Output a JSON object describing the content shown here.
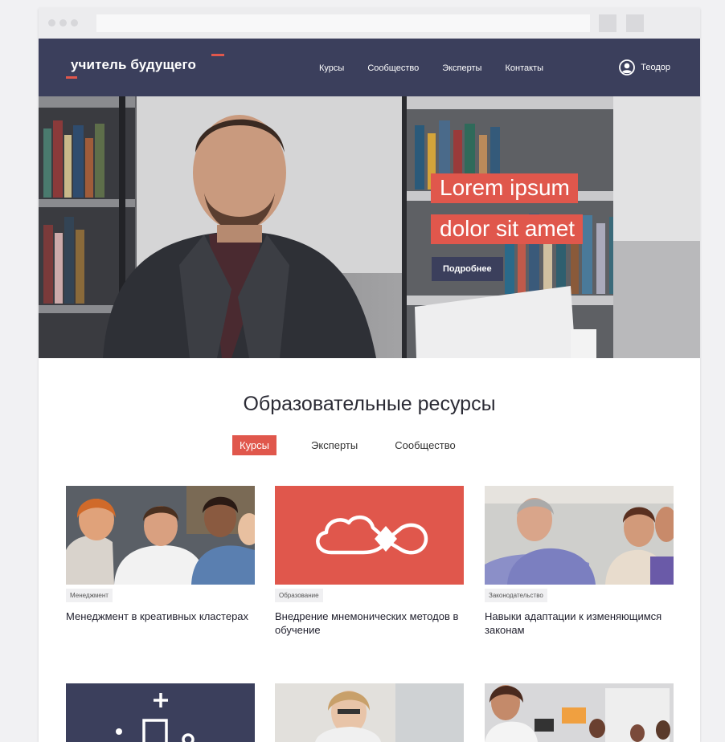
{
  "site": {
    "logo": "учитель будущего",
    "nav": [
      "Курсы",
      "Сообщество",
      "Эксперты",
      "Контакты"
    ],
    "user_name": "Теодор"
  },
  "hero": {
    "line1": "Lorem ipsum",
    "line2": "dolor sit amet",
    "button": "Подробнее"
  },
  "resources": {
    "title": "Образовательные ресурсы",
    "tabs": [
      "Курсы",
      "Эксперты",
      "Сообщество"
    ],
    "active_tab": "Курсы",
    "cards": [
      {
        "tag": "Менеджмент",
        "title": "Менеджмент в креативных кластерах"
      },
      {
        "tag": "Образование",
        "title": "Внедрение мнемонических методов в обучение"
      },
      {
        "tag": "Законодательство",
        "title": "Навыки адаптации к изменяющимся законам"
      }
    ]
  },
  "colors": {
    "navy": "#3b3f5c",
    "coral": "#e0574c"
  },
  "icons": [
    "user-circle-icon",
    "cloud-infinity-icon",
    "plus-icon"
  ]
}
